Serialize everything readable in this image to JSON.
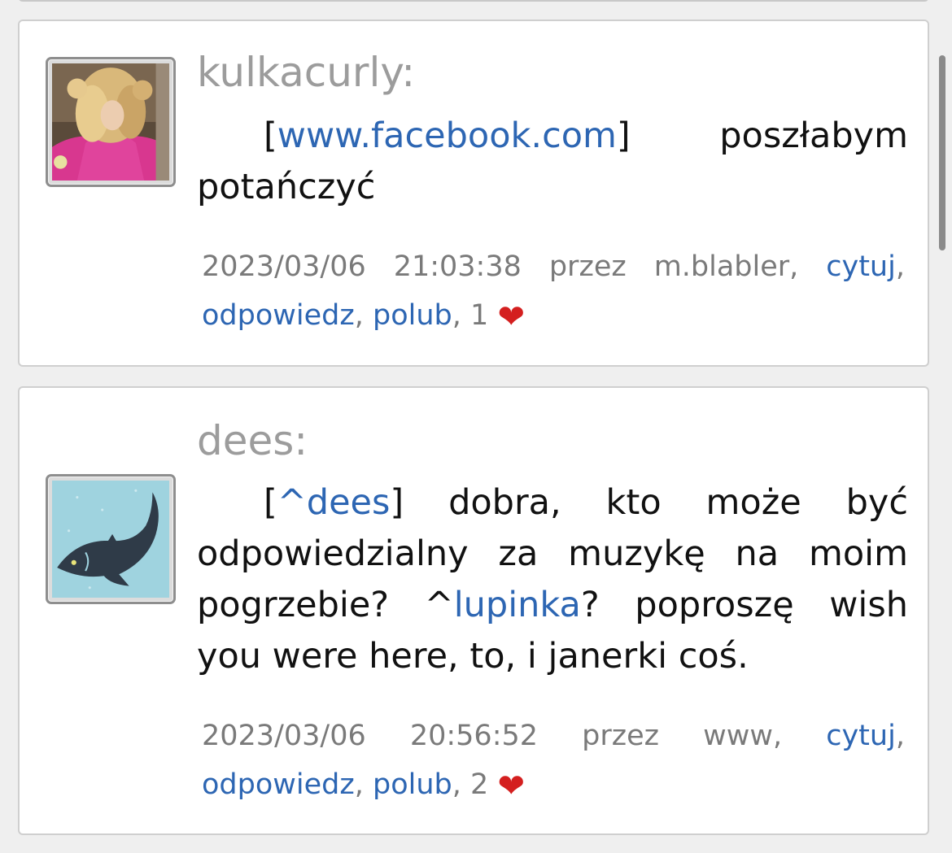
{
  "posts": [
    {
      "author": "kulkacurly:",
      "avatar_icon": "curly-hair-woman-avatar",
      "reply_open": "[",
      "reply_link": "www.facebook.com",
      "reply_close": "]",
      "text_after": " poszłabym potańczyć",
      "date": "2023/03/06",
      "time": "21:03:38",
      "przez": "przez",
      "via": "m.blabler,",
      "quote_label": "cytuj",
      "reply_label": "odpowiedz",
      "like_label": "polub",
      "like_count": "1",
      "heart": "❤"
    },
    {
      "author": "dees:",
      "avatar_icon": "fish-avatar",
      "reply_open": "[",
      "reply_link": "^dees",
      "reply_close": "]",
      "text_before_mention": " dobra, kto może być odpowiedzialny za muzykę na moim pogrzebie? ^",
      "mention_link": "lupinka",
      "text_after_mention": "? poproszę wish you were here, to, i janerki coś.",
      "date": "2023/03/06",
      "time": "20:56:52",
      "przez": "przez",
      "via": "www,",
      "quote_label": "cytuj",
      "reply_label": "odpowiedz",
      "like_label": "polub",
      "like_count": "2",
      "heart": "❤"
    }
  ],
  "colors": {
    "link": "#2d66b3",
    "author": "#9c9c9c",
    "meta": "#7a7a7a",
    "heart": "#d41f1f"
  }
}
